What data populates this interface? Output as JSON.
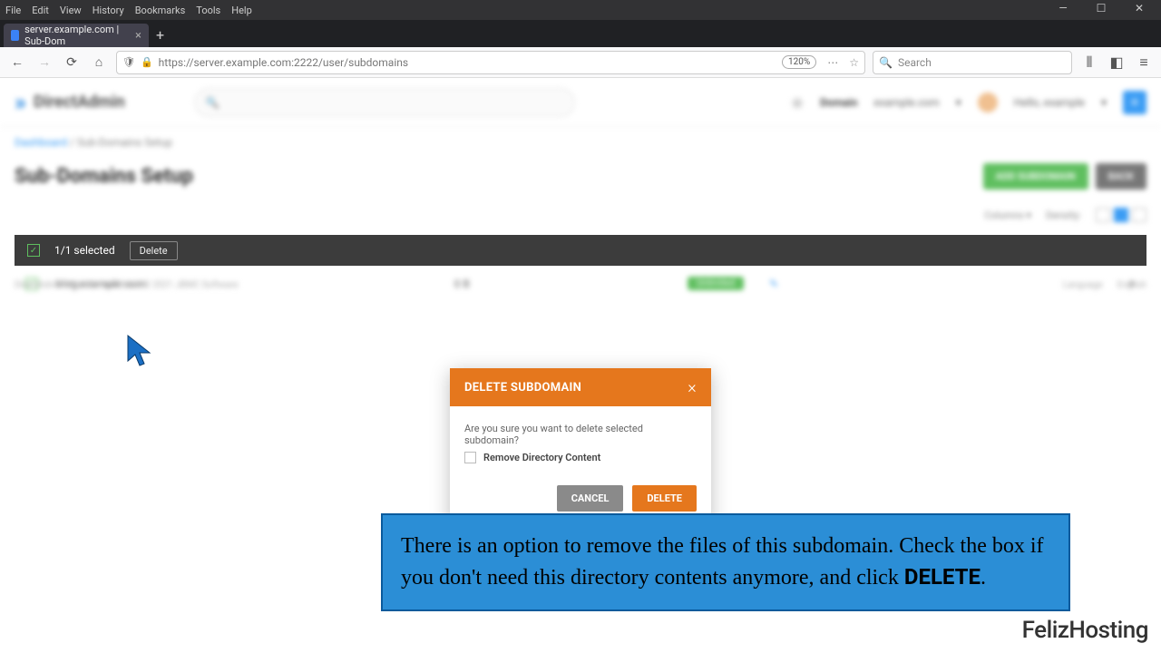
{
  "browser": {
    "menu": [
      "File",
      "Edit",
      "View",
      "History",
      "Bookmarks",
      "Tools",
      "Help"
    ],
    "tab_title": "server.example.com | Sub-Dom",
    "url": "https://server.example.com:2222/user/subdomains",
    "zoom": "120%",
    "search_placeholder": "Search"
  },
  "header": {
    "brand": "DirectAdmin",
    "domain_label": "Domain",
    "domain_value": "example.com",
    "hello": "Hello, example"
  },
  "breadcrumb": {
    "root": "Dashboard",
    "current": "Sub-Domains Setup"
  },
  "page_title": "Sub-Domains Setup",
  "buttons": {
    "add": "ADD SUBDOMAIN",
    "back": "BACK"
  },
  "options": {
    "columns": "Columns",
    "density": "Density:"
  },
  "selection": {
    "count": "1/1 selected",
    "delete": "Delete"
  },
  "row": {
    "name": "blog.example.com",
    "usage": "0 B",
    "status": "Unlimited"
  },
  "modal": {
    "title": "DELETE SUBDOMAIN",
    "message": "Are you sure you want to delete selected subdomain?",
    "checkbox": "Remove Directory Content",
    "cancel": "CANCEL",
    "delete": "DELETE"
  },
  "callout": "There is an option to remove the files of this subdomain. Check the box if you don't need this directory contents anymore, and click <b>DELETE</b>.",
  "footer": {
    "left": "DirectAdmin Web Control Panel © 2021 JBMC Software",
    "lang_label": "Language",
    "lang_value": "English"
  },
  "watermark": "FelizHosting"
}
